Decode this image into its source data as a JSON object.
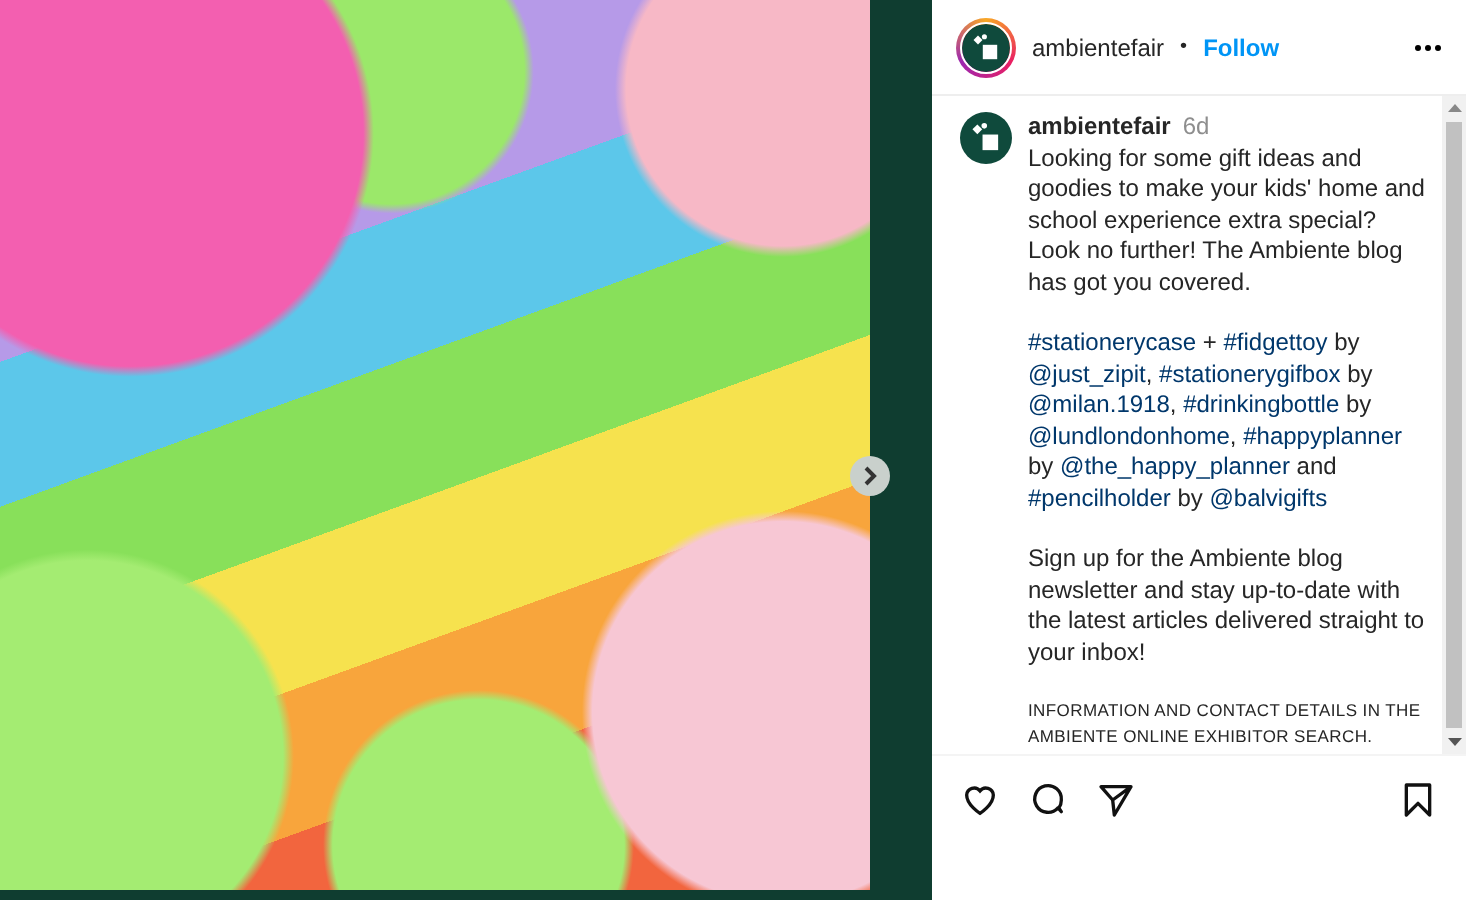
{
  "header": {
    "username": "ambientefair",
    "separator": "•",
    "follow": "Follow"
  },
  "caption": {
    "username": "ambientefair",
    "time": "6d",
    "paragraphs": [
      {
        "kind": "body",
        "segments": [
          {
            "kind": "text",
            "text": "Looking for some gift ideas and goodies to make your kids' home and school experience extra special? Look no further! The Ambiente blog has got you covered."
          }
        ]
      },
      {
        "kind": "body",
        "segments": [
          {
            "kind": "hashtag",
            "text": "#stationerycase"
          },
          {
            "kind": "text",
            "text": " + "
          },
          {
            "kind": "hashtag",
            "text": "#fidgettoy"
          },
          {
            "kind": "text",
            "text": " by "
          },
          {
            "kind": "mention",
            "text": "@just_zipit"
          },
          {
            "kind": "text",
            "text": ", "
          },
          {
            "kind": "hashtag",
            "text": "#stationerygifbox"
          },
          {
            "kind": "text",
            "text": " by "
          },
          {
            "kind": "mention",
            "text": "@milan.1918"
          },
          {
            "kind": "text",
            "text": ", "
          },
          {
            "kind": "hashtag",
            "text": "#drinkingbottle"
          },
          {
            "kind": "text",
            "text": " by "
          },
          {
            "kind": "mention",
            "text": "@lundlondonhome"
          },
          {
            "kind": "text",
            "text": ", "
          },
          {
            "kind": "hashtag",
            "text": "#happyplanner"
          },
          {
            "kind": "text",
            "text": " by "
          },
          {
            "kind": "mention",
            "text": "@the_happy_planner"
          },
          {
            "kind": "text",
            "text": " and "
          },
          {
            "kind": "hashtag",
            "text": "#pencilholder"
          },
          {
            "kind": "text",
            "text": " by "
          },
          {
            "kind": "mention",
            "text": "@balvigifts"
          }
        ]
      },
      {
        "kind": "body",
        "segments": [
          {
            "kind": "text",
            "text": "Sign up for the Ambiente blog newsletter and stay up-to-date with the latest articles delivered straight to your inbox!"
          }
        ]
      },
      {
        "kind": "small",
        "segments": [
          {
            "kind": "text",
            "text": "INFORMATION AND CONTACT DETAILS IN THE AMBIENTE ONLINE EXHIBITOR SEARCH."
          }
        ]
      }
    ]
  }
}
